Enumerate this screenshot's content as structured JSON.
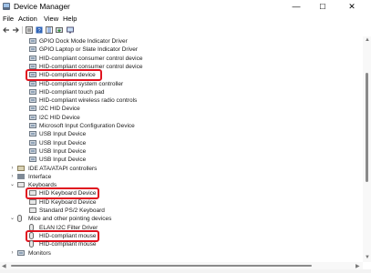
{
  "window": {
    "title": "Device Manager",
    "controls": {
      "minimize": "—",
      "maximize": "☐",
      "close": "✕"
    }
  },
  "menu": [
    "File",
    "Action",
    "View",
    "Help"
  ],
  "toolbar": {
    "buttons": [
      "back-arrow-icon",
      "forward-arrow-icon",
      "properties-icon",
      "help-icon",
      "device-list-icon",
      "update-driver-icon",
      "scan-hardware-icon"
    ]
  },
  "tree": {
    "rows": [
      {
        "label": "GPIO Dock Mode Indicator Driver",
        "level": 3,
        "icon": "device-icon",
        "expander": ""
      },
      {
        "label": "GPIO Laptop or Slate Indicator Driver",
        "level": 3,
        "icon": "device-icon",
        "expander": ""
      },
      {
        "label": "HID-compliant consumer control device",
        "level": 3,
        "icon": "device-icon",
        "expander": ""
      },
      {
        "label": "HID-compliant consumer control device",
        "level": 3,
        "icon": "device-icon",
        "expander": ""
      },
      {
        "label": "HID-compliant device",
        "level": 3,
        "icon": "device-icon",
        "expander": "",
        "highlighted": true
      },
      {
        "label": "HID-compliant system controller",
        "level": 3,
        "icon": "device-icon",
        "expander": ""
      },
      {
        "label": "HID-compliant touch pad",
        "level": 3,
        "icon": "device-icon",
        "expander": ""
      },
      {
        "label": "HID-compliant wireless radio controls",
        "level": 3,
        "icon": "device-icon",
        "expander": ""
      },
      {
        "label": "I2C HID Device",
        "level": 3,
        "icon": "device-icon",
        "expander": ""
      },
      {
        "label": "I2C HID Device",
        "level": 3,
        "icon": "device-icon",
        "expander": ""
      },
      {
        "label": "Microsoft Input Configuration Device",
        "level": 3,
        "icon": "device-icon",
        "expander": ""
      },
      {
        "label": "USB Input Device",
        "level": 3,
        "icon": "device-icon",
        "expander": ""
      },
      {
        "label": "USB Input Device",
        "level": 3,
        "icon": "device-icon",
        "expander": ""
      },
      {
        "label": "USB Input Device",
        "level": 3,
        "icon": "device-icon",
        "expander": ""
      },
      {
        "label": "USB Input Device",
        "level": 3,
        "icon": "device-icon",
        "expander": ""
      },
      {
        "label": "IDE ATA/ATAPI controllers",
        "level": 2,
        "icon": "ide-controller-icon",
        "expander": ">"
      },
      {
        "label": "Interface",
        "level": 2,
        "icon": "interface-icon",
        "expander": ">"
      },
      {
        "label": "Keyboards",
        "level": 2,
        "icon": "keyboard-category-icon",
        "expander": "v"
      },
      {
        "label": "HID Keyboard Device",
        "level": 3,
        "icon": "keyboard-icon",
        "expander": "",
        "highlighted": true
      },
      {
        "label": "HID Keyboard Device",
        "level": 3,
        "icon": "keyboard-icon",
        "expander": ""
      },
      {
        "label": "Standard PS/2 Keyboard",
        "level": 3,
        "icon": "keyboard-icon",
        "expander": ""
      },
      {
        "label": "Mice and other pointing devices",
        "level": 2,
        "icon": "mouse-category-icon",
        "expander": "v"
      },
      {
        "label": "ELAN I2C Filter Driver",
        "level": 3,
        "icon": "mouse-icon",
        "expander": ""
      },
      {
        "label": "HID-compliant mouse",
        "level": 3,
        "icon": "mouse-icon",
        "expander": "",
        "highlighted": true
      },
      {
        "label": "HID-compliant mouse",
        "level": 3,
        "icon": "mouse-icon",
        "expander": ""
      },
      {
        "label": "Monitors",
        "level": 2,
        "icon": "monitor-icon",
        "expander": ">"
      }
    ]
  },
  "colors": {
    "highlight": "#e0131f",
    "text": "#1a1a1a"
  }
}
